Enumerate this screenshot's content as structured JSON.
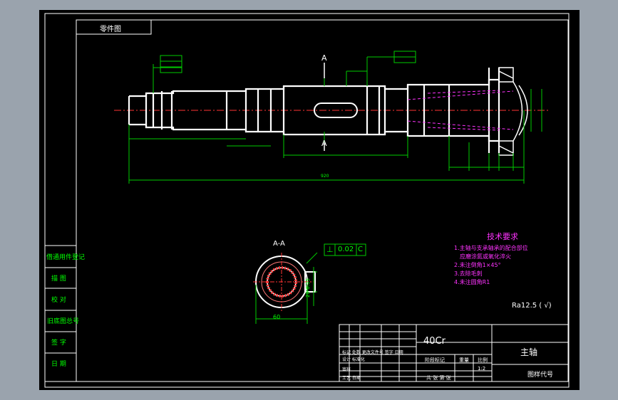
{
  "drawing_title": "零件图",
  "technical_requirements": {
    "title": "技术要求",
    "items": [
      "1.主轴与支承轴承的配合部位",
      "应磨涂氮或氧化淬火",
      "2.未注倒角1×45°",
      "3.去除毛刺",
      "4.未注圆角R1"
    ]
  },
  "roughness_note": "Ra12.5 ( √)",
  "tolerance_frame": {
    "symbol": "⊥",
    "value": "0.02",
    "datum": "C"
  },
  "section_labels": {
    "cut_mark": "A",
    "section_name": "A-A"
  },
  "section_dims": {
    "width": "60",
    "height": "20-0.05"
  },
  "overall_length": "920",
  "sidebar_labels": [
    "借通用件登记",
    "描 图",
    "校 对",
    "旧底图总号",
    "签 字",
    "日 期"
  ],
  "title_block": {
    "material": "40Cr",
    "part_name": "主轴",
    "drawing_no_label": "图样代号",
    "scale_header": "阶段标记",
    "weight_header": "重量",
    "scale_value_header": "比例",
    "scale_value": "1:2",
    "sheets": "共 张 第 张",
    "rows": [
      "标记 处数 更改文件号 签字 日期",
      "设计 标准化",
      "审核",
      "工艺 日期"
    ]
  }
}
